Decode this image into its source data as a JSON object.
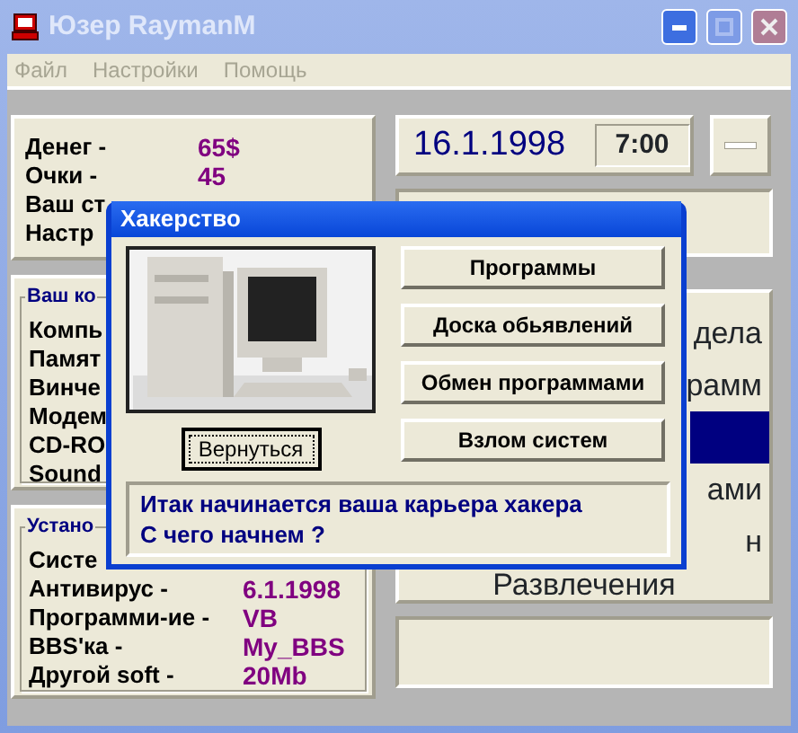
{
  "window": {
    "title": "Юзер RaymanM"
  },
  "menu": [
    {
      "label": "Файл",
      "disabled": true
    },
    {
      "label": "Настройки",
      "disabled": true
    },
    {
      "label": "Помощь",
      "disabled": true
    }
  ],
  "stats": [
    {
      "label": "Денег -",
      "value": "65$"
    },
    {
      "label": "Очки -",
      "value": "45"
    },
    {
      "label": "Ваш ст"
    },
    {
      "label": "Настр"
    }
  ],
  "computer": {
    "title": "Ваш ко",
    "items": [
      "Компь",
      "Памят",
      "Винче",
      "Модем",
      "CD-RO",
      "Sound"
    ]
  },
  "installed": {
    "title": "Устано",
    "items": [
      {
        "label": "Систе"
      },
      {
        "label": "Антивирус -",
        "value": "6.1.1998"
      },
      {
        "label": "Программи-ие -",
        "value": "VB"
      },
      {
        "label": "BBS'ка -",
        "value": "My_BBS"
      },
      {
        "label": "Другой soft -",
        "value": "20Mb"
      }
    ]
  },
  "date": "16.1.1998",
  "time": "7:00",
  "sections": [
    {
      "label": "дела",
      "kind": "partial",
      "selected": false
    },
    {
      "label": "рамм",
      "kind": "partial",
      "selected": false
    },
    {
      "kind": "partial",
      "selected": true
    },
    {
      "label": "ами",
      "kind": "partial",
      "selected": false
    },
    {
      "label": "н",
      "kind": "partial",
      "selected": false
    },
    {
      "label": "Развлечения",
      "kind": "full",
      "selected": false
    }
  ],
  "dialog": {
    "title": "Хакерство",
    "back_button": "Вернуться",
    "buttons": [
      "Программы",
      "Доска обьявлений",
      "Обмен программами",
      "Взлом систем"
    ],
    "message": [
      "Итак начинается ваша карьера хакера",
      "С чего начнем ?"
    ]
  }
}
